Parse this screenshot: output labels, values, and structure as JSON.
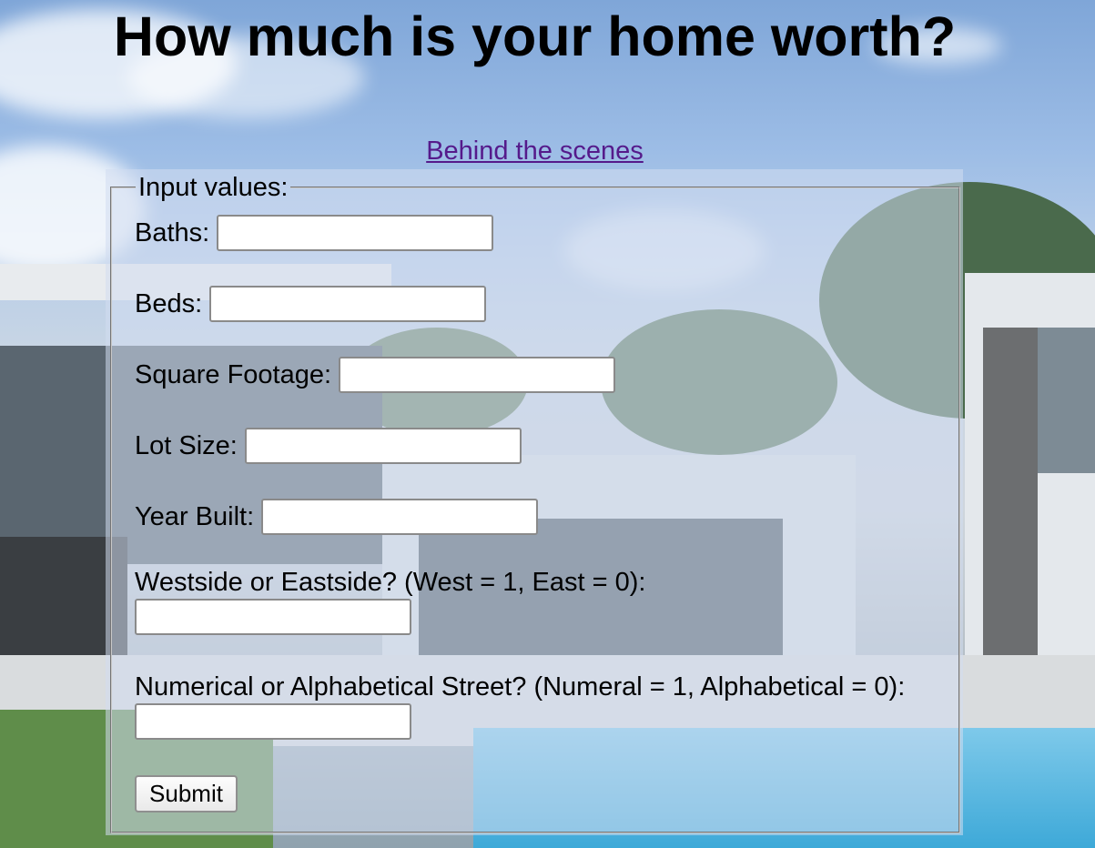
{
  "page": {
    "title": "How much is your home worth?",
    "link_label": "Behind the scenes"
  },
  "form": {
    "legend": "Input values:",
    "fields": {
      "baths": {
        "label": "Baths:",
        "value": ""
      },
      "beds": {
        "label": "Beds:",
        "value": ""
      },
      "square_footage": {
        "label": "Square Footage:",
        "value": ""
      },
      "lot_size": {
        "label": "Lot Size:",
        "value": ""
      },
      "year_built": {
        "label": "Year Built:",
        "value": ""
      },
      "west_east": {
        "label": "Westside or Eastside? (West = 1, East = 0):",
        "value": ""
      },
      "street_type": {
        "label": "Numerical or Alphabetical Street? (Numeral = 1, Alphabetical = 0):",
        "value": ""
      }
    },
    "submit_label": "Submit"
  },
  "background": {
    "description_icon": "house-photo-background",
    "link_color": "#551a8b"
  }
}
